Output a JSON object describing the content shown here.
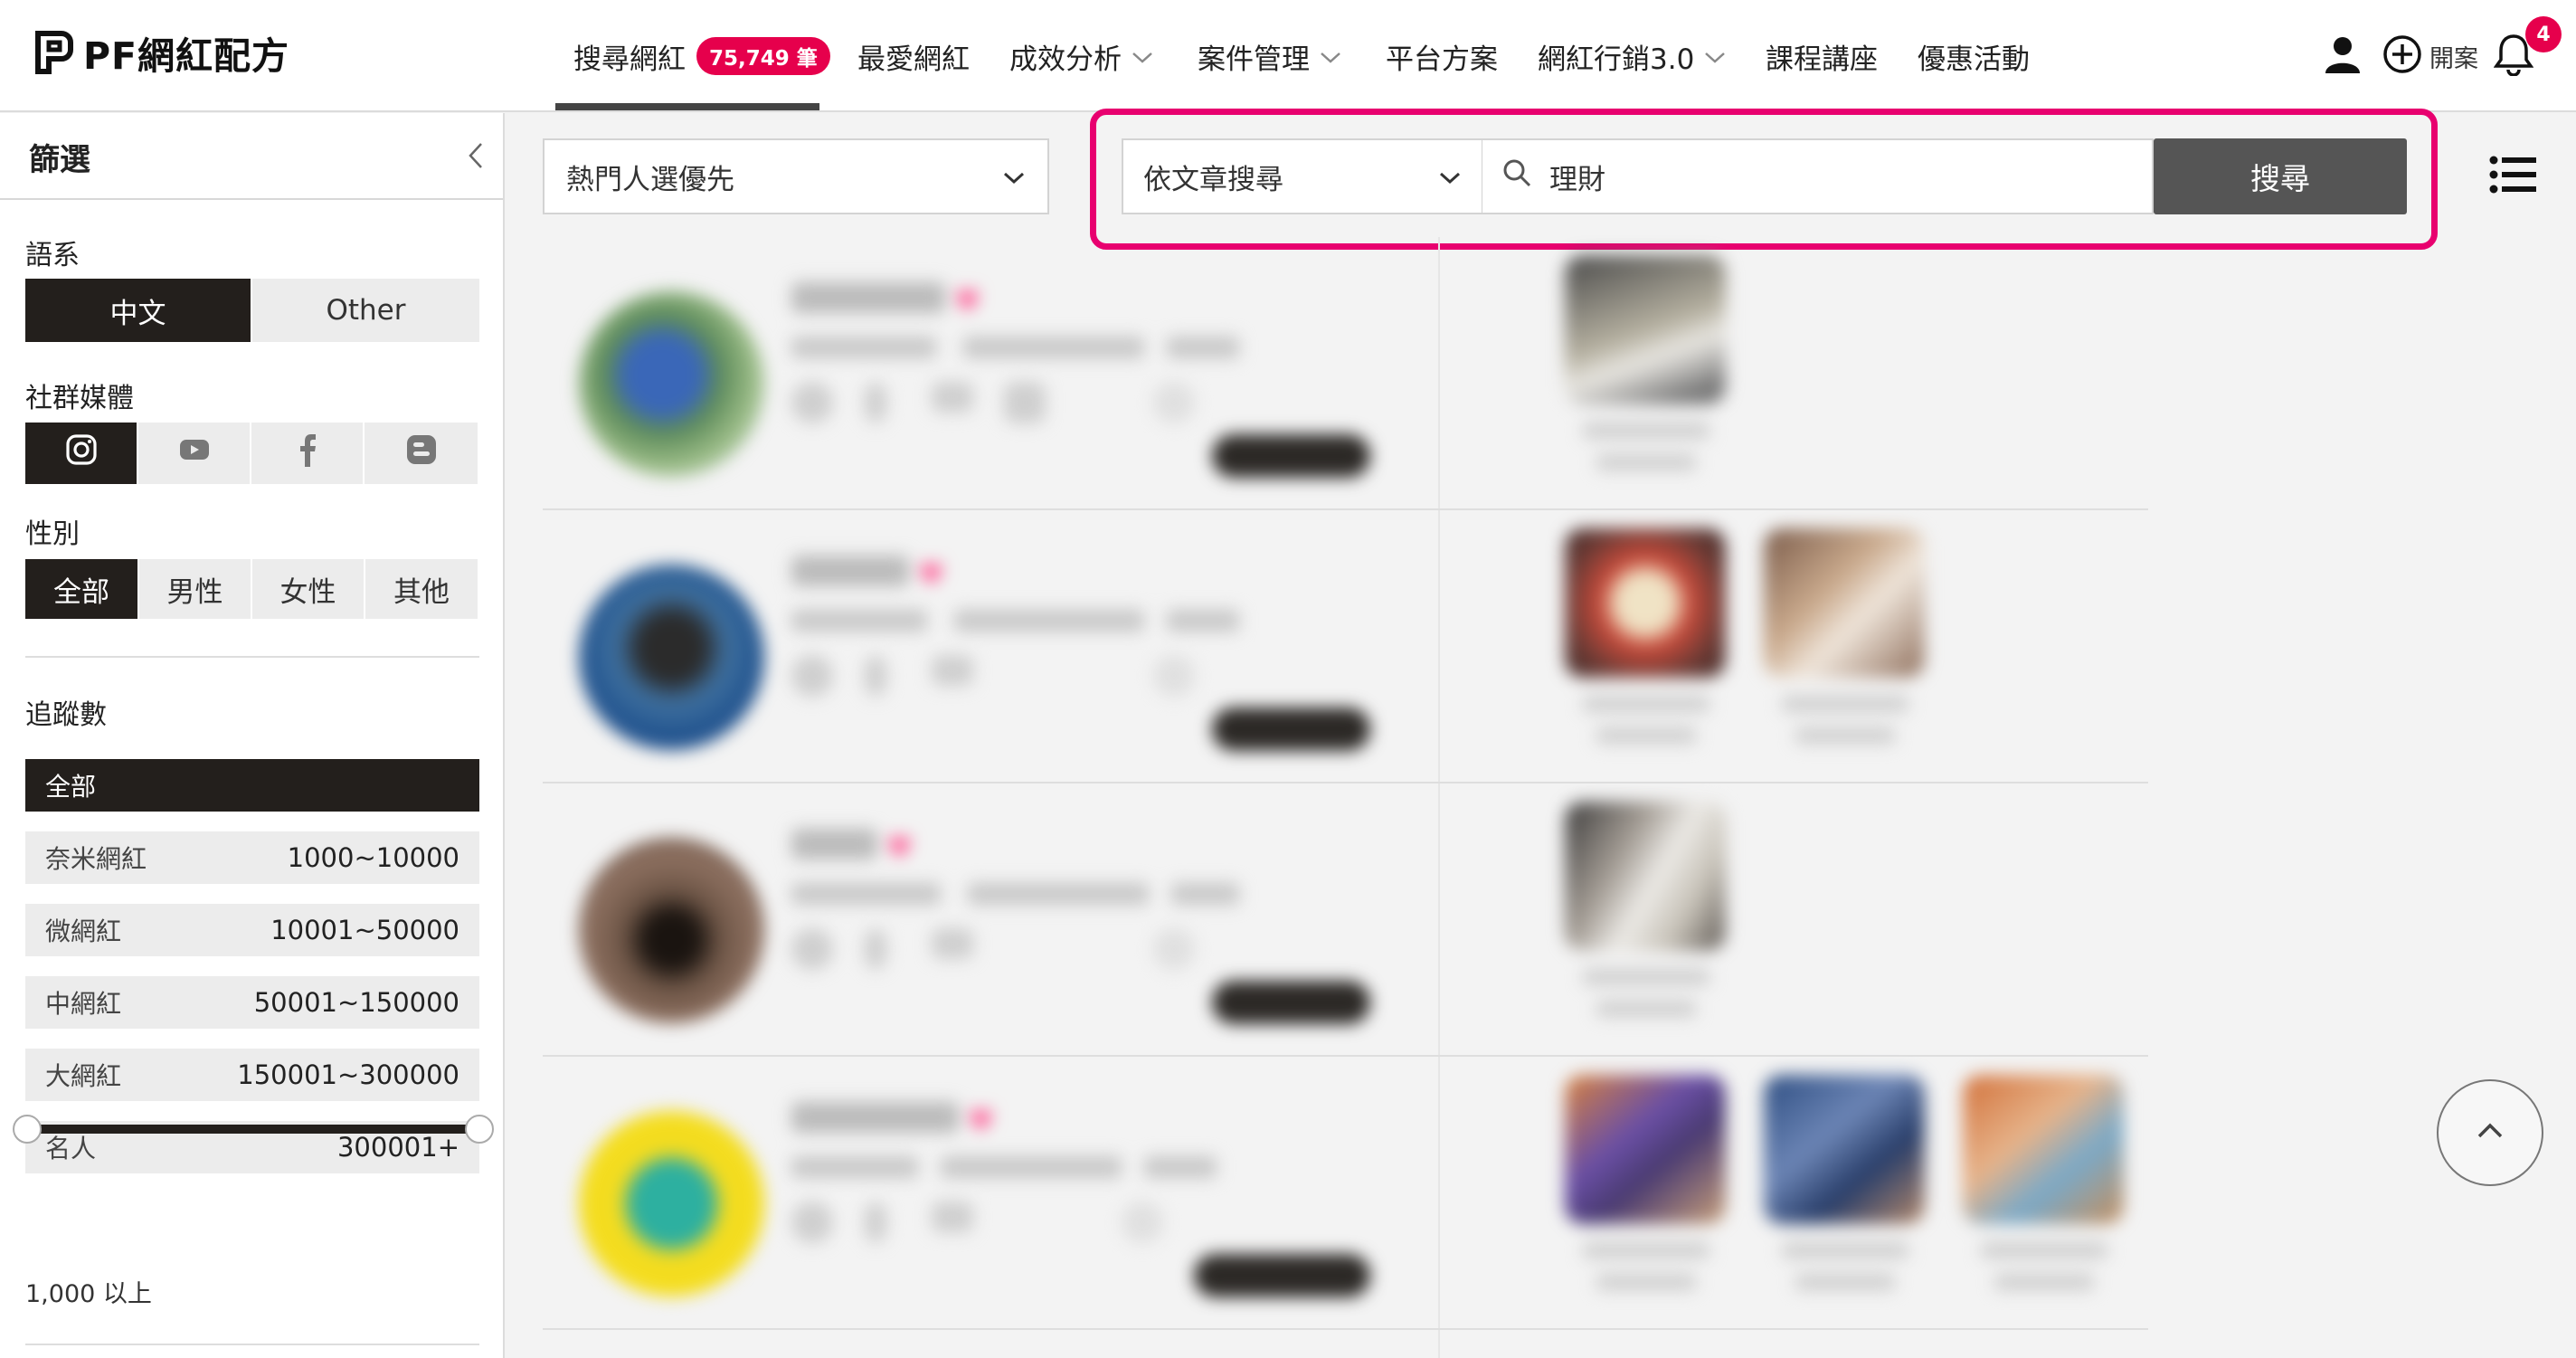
{
  "brand": {
    "name": "PF網紅配方",
    "accent_color": "#e6004c",
    "dark_color": "#231f1c"
  },
  "nav": {
    "items": [
      {
        "label": "搜尋網紅",
        "badge": "75,749 筆",
        "active": true,
        "has_dropdown": false
      },
      {
        "label": "最愛網紅",
        "has_dropdown": false
      },
      {
        "label": "成效分析",
        "has_dropdown": true
      },
      {
        "label": "案件管理",
        "has_dropdown": true
      },
      {
        "label": "平台方案",
        "has_dropdown": false
      },
      {
        "label": "網紅行銷3.0",
        "has_dropdown": true
      },
      {
        "label": "課程講座",
        "has_dropdown": false
      },
      {
        "label": "優惠活動",
        "has_dropdown": false
      }
    ],
    "user_icon": "user-icon",
    "new_case_label": "開案",
    "notification_count": "4"
  },
  "sidebar": {
    "title": "篩選",
    "language": {
      "label": "語系",
      "options": [
        "中文",
        "Other"
      ],
      "selected": "中文"
    },
    "social": {
      "label": "社群媒體",
      "options": [
        "instagram-icon",
        "youtube-icon",
        "facebook-icon",
        "blog-icon"
      ],
      "selected": "instagram-icon"
    },
    "gender": {
      "label": "性別",
      "options": [
        "全部",
        "男性",
        "女性",
        "其他"
      ],
      "selected": "全部"
    },
    "followers": {
      "label": "追蹤數",
      "tiers": [
        {
          "name": "全部",
          "range": "",
          "active": true
        },
        {
          "name": "奈米網紅",
          "range": "1000~10000"
        },
        {
          "name": "微網紅",
          "range": "10001~50000"
        },
        {
          "name": "中網紅",
          "range": "50001~150000"
        },
        {
          "name": "大網紅",
          "range": "150001~300000"
        },
        {
          "name": "名人",
          "range": "300001+"
        }
      ],
      "slider_caption": "1,000 以上"
    }
  },
  "toolbar": {
    "sort_value": "熱門人選優先",
    "search_type_value": "依文章搜尋",
    "search_query": "理財",
    "search_button": "搜尋",
    "view_icon": "list-view-icon"
  },
  "results": {
    "note": "blurred result cards",
    "cards": 4
  }
}
